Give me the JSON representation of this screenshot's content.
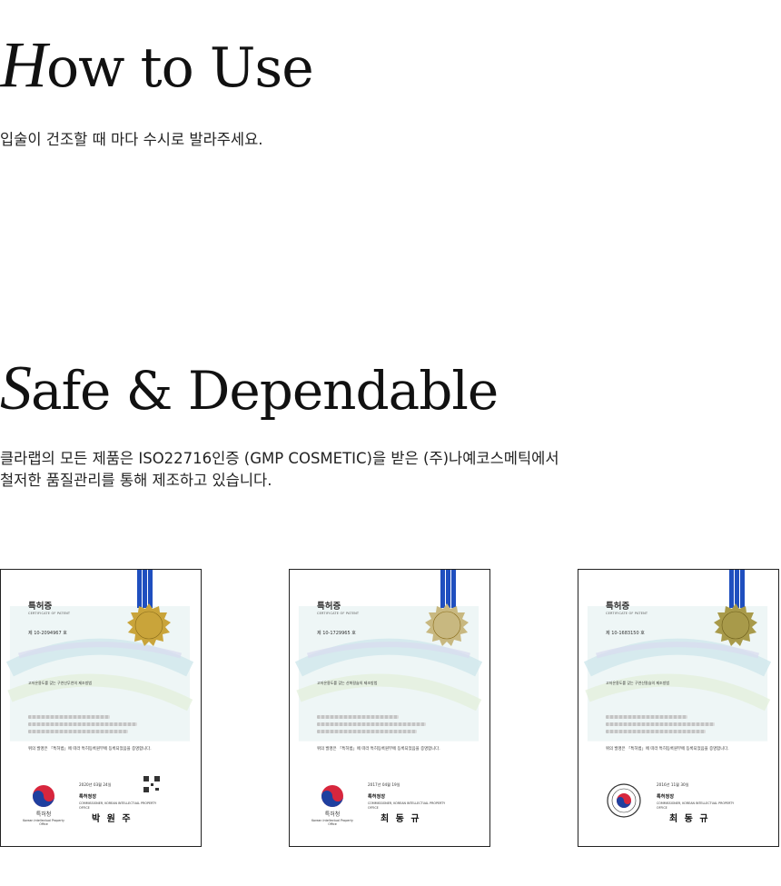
{
  "sections": {
    "how_to_use": {
      "title_initial": "H",
      "title_rest": "ow to Use",
      "body": "입술이 건조할 때 마다 수시로 발라주세요."
    },
    "safe": {
      "title_initial": "S",
      "title_rest": "afe & Dependable",
      "body_line1": "클라랩의 모든 제품은 ISO22716인증 (GMP COSMETIC)을 받은 (주)나예코스메틱에서",
      "body_line2": "철저한 품질관리를 통해 제조하고 있습니다."
    }
  },
  "certificates": [
    {
      "title": "특허증",
      "subtitle": "CERTIFICATE OF PATENT",
      "number": "제 10-2094967 호",
      "invention": "고저온용도를 갖는 구연산무연의 제조방법",
      "statement": "위의 발명은 「특허법」에 따라 특허등록원부에 등록되었음을 증명합니다.",
      "date": "2020년 03월 24일",
      "office": "특허청장",
      "commissioner": "COMMISSIONER, KOREAN INTELLECTUAL PROPERTY OFFICE",
      "signature": "박 원 주",
      "emblem_label": "특허청",
      "emblem_sub": "Korean Intellectual Property Office",
      "emblem_icon": "kipo-taeguk-icon",
      "seal_color": "#c9a43a",
      "ribbon_color": "#1f4fbf"
    },
    {
      "title": "특허증",
      "subtitle": "CERTIFICATE OF PATENT",
      "number": "제 10-1729965 호",
      "invention": "고저온용도를 갖는 산화칼슘의 제조방법",
      "statement": "위의 발명은 「특허법」에 따라 특허등록원부에 등록되었음을 증명합니다.",
      "date": "2017년 04월 19일",
      "office": "특허청장",
      "commissioner": "COMMISSIONER, KOREAN INTELLECTUAL PROPERTY OFFICE",
      "signature": "최 동 규",
      "emblem_label": "특허청",
      "emblem_sub": "Korean Intellectual Property Office",
      "emblem_icon": "kipo-taeguk-icon",
      "seal_color": "#c8b880",
      "ribbon_color": "#1f4fbf"
    },
    {
      "title": "특허증",
      "subtitle": "CERTIFICATE OF PATENT",
      "number": "제 10-1683150 호",
      "invention": "고저온용도를 갖는 구연산칼슘의 제조방법",
      "statement": "위의 발명은 「특허법」에 따라 특허등록원부에 등록되었음을 증명합니다.",
      "date": "2016년 11월 30일",
      "office": "특허청장",
      "commissioner": "COMMISSIONER, KOREAN INTELLECTUAL PROPERTY OFFICE",
      "signature": "최 동 규",
      "emblem_label": "",
      "emblem_sub": "",
      "emblem_icon": "kipo-round-seal-icon",
      "seal_color": "#a89a4a",
      "ribbon_color": "#1f4fbf"
    }
  ]
}
